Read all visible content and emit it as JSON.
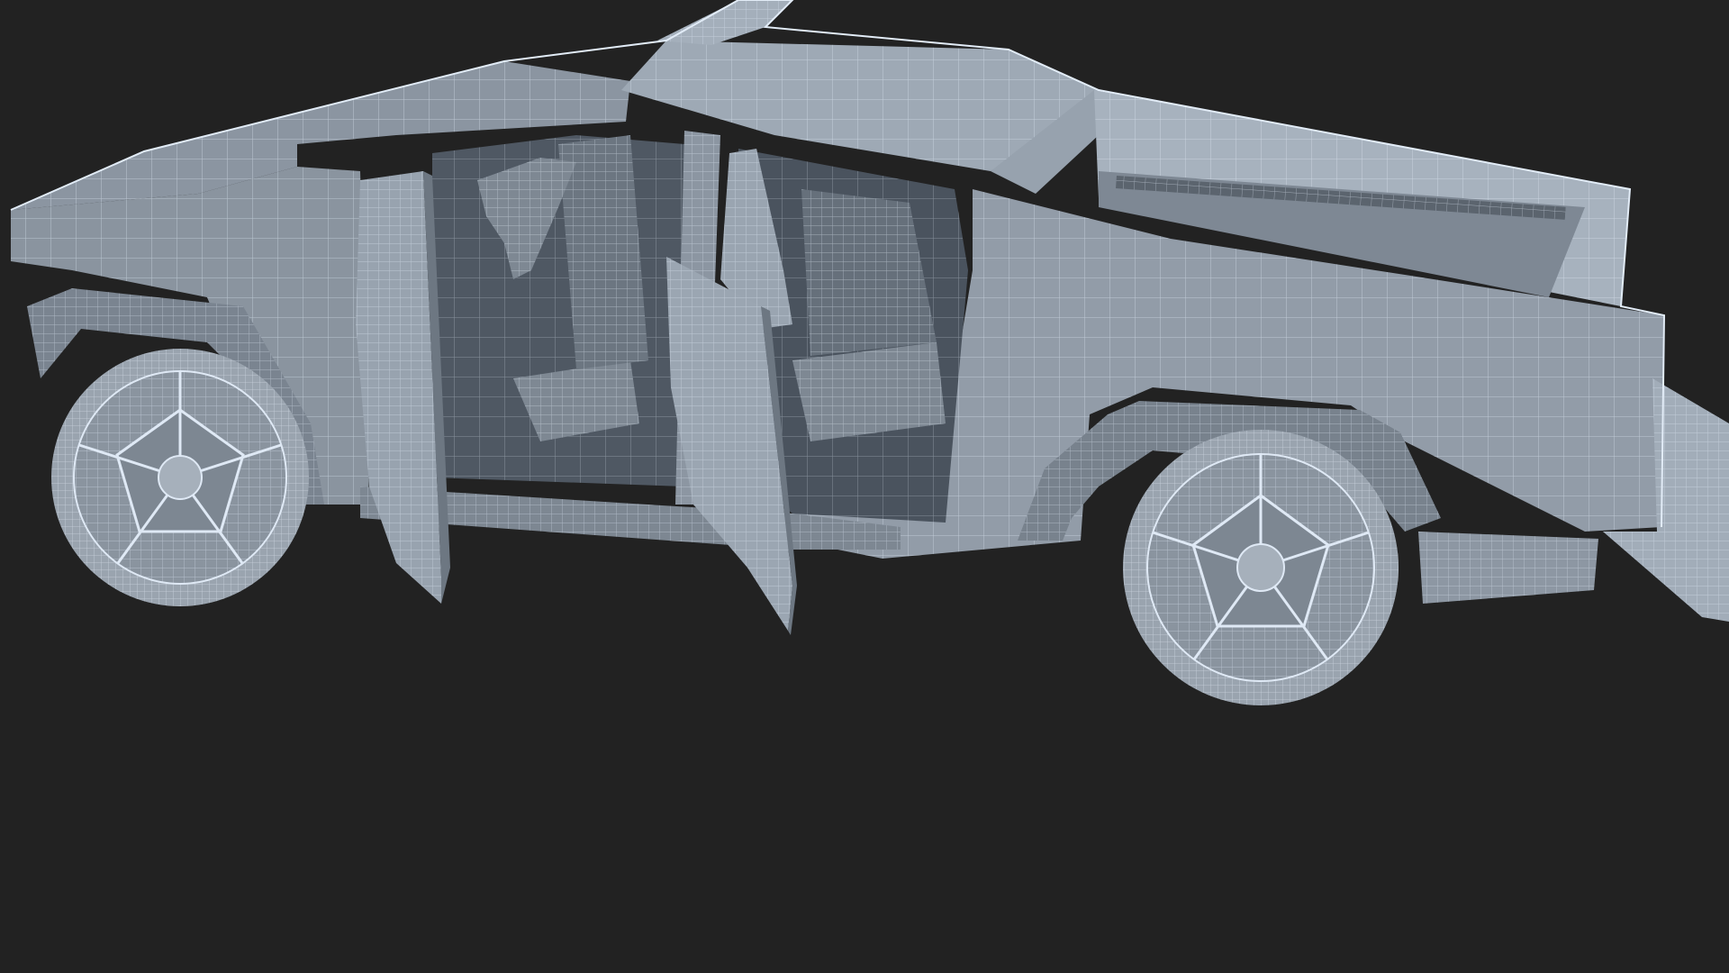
{
  "scene": {
    "subject": "wireframe-pickup-truck",
    "colors": {
      "background": "#222222",
      "body_base": "#8e98a3",
      "body_light": "#aeb8c4",
      "body_mid": "#7b8591",
      "body_dark": "#5c6570",
      "interior": "#4f5863",
      "interior_dark": "#3c434c",
      "wire": "#dfe9f5",
      "tire": "#9aa4af"
    }
  }
}
